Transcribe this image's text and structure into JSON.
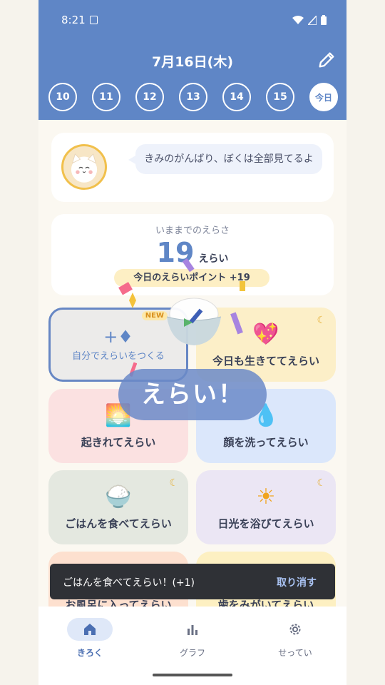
{
  "status": {
    "time": "8:21"
  },
  "header": {
    "date_title": "7月16日(木)",
    "days": [
      "10",
      "11",
      "12",
      "13",
      "14",
      "15",
      "今日"
    ]
  },
  "speech": {
    "text": "きみのがんばり、ぼくは全部見てるよ"
  },
  "score": {
    "label": "いままでのえらさ",
    "value": "19",
    "unit": "えらい",
    "today_points": "今日のえらいポイント +19"
  },
  "tiles": [
    {
      "label": "自分でえらいをつくる",
      "icon": "plus-diamond-icon",
      "badge": "NEW"
    },
    {
      "label": "今日も生きててえらい",
      "icon": "sparkle-heart-icon",
      "color": "#fcefc8"
    },
    {
      "label": "起きれてえらい",
      "icon": "sunrise-icon",
      "color": "#fbe1e1"
    },
    {
      "label": "顔を洗ってえらい",
      "icon": "droplet-icon",
      "color": "#dbe7fb"
    },
    {
      "label": "ごはんを食べてえらい",
      "icon": "rice-bowl-icon",
      "color": "#e4e8e0"
    },
    {
      "label": "日光を浴びてえらい",
      "icon": "sun-icon",
      "color": "#ebe6f4"
    },
    {
      "label": "お風呂に入ってえらい",
      "icon": "bath-icon",
      "color": "#fde0cf"
    },
    {
      "label": "歯をみがいてえらい",
      "icon": "tooth-icon",
      "color": "#fdf0c2"
    }
  ],
  "overlay": {
    "text": "えらい！"
  },
  "snackbar": {
    "message": "ごはんを食べてえらい！(+1)",
    "action": "取り消す"
  },
  "nav": [
    {
      "label": "きろく",
      "icon": "home-icon"
    },
    {
      "label": "グラフ",
      "icon": "bar-chart-icon"
    },
    {
      "label": "せってい",
      "icon": "gear-icon"
    }
  ],
  "colors": {
    "header": "#5f86c6",
    "accent": "#5f86c6",
    "snackbar": "#2f3136"
  }
}
